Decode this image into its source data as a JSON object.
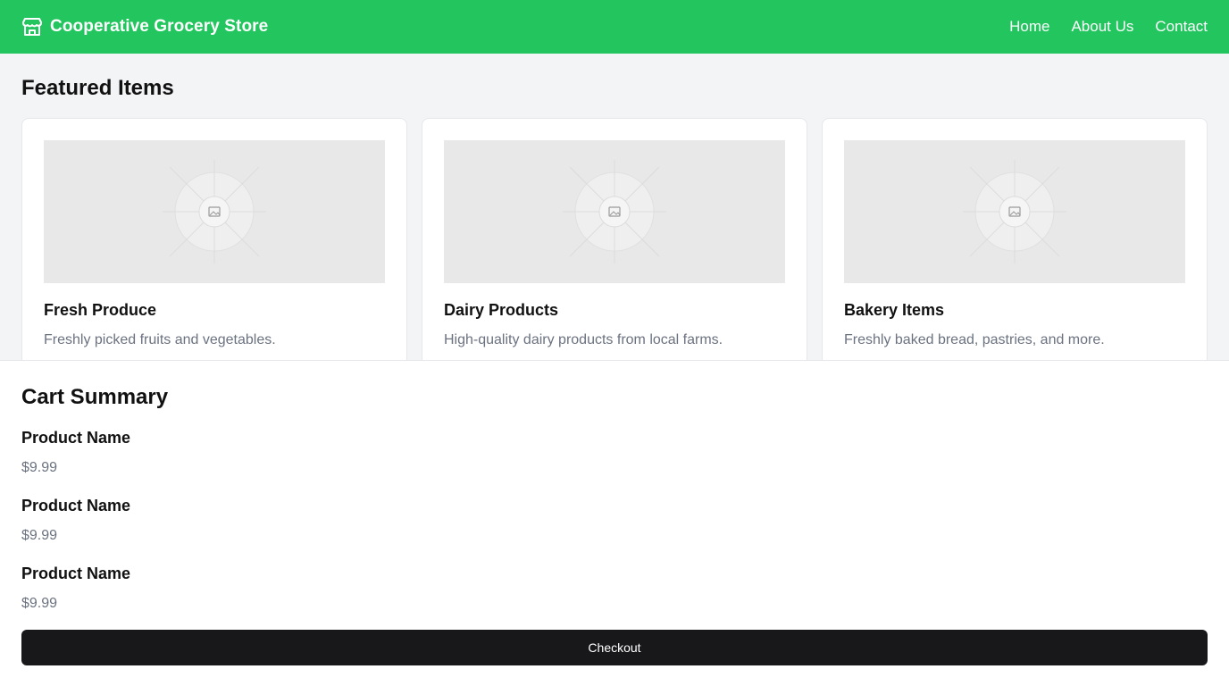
{
  "header": {
    "brand_icon": "store-icon",
    "brand_name": "Cooperative Grocery Store",
    "nav": [
      {
        "label": "Home"
      },
      {
        "label": "About Us"
      },
      {
        "label": "Contact"
      }
    ],
    "accent_color": "#22c55e"
  },
  "featured": {
    "title": "Featured Items",
    "items": [
      {
        "title": "Fresh Produce",
        "description": "Freshly picked fruits and vegetables.",
        "image_icon": "image-placeholder-icon"
      },
      {
        "title": "Dairy Products",
        "description": "High-quality dairy products from local farms.",
        "image_icon": "image-placeholder-icon"
      },
      {
        "title": "Bakery Items",
        "description": "Freshly baked bread, pastries, and more.",
        "image_icon": "image-placeholder-icon"
      }
    ]
  },
  "cart": {
    "title": "Cart Summary",
    "items": [
      {
        "name": "Product Name",
        "price": "$9.99"
      },
      {
        "name": "Product Name",
        "price": "$9.99"
      },
      {
        "name": "Product Name",
        "price": "$9.99"
      }
    ],
    "checkout_label": "Checkout",
    "button_color": "#18181b"
  }
}
